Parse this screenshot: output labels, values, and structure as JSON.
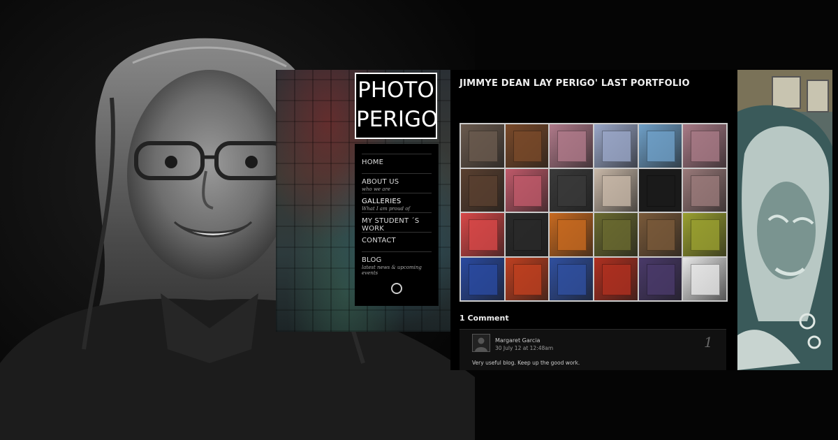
{
  "logo": {
    "line1": "PHOTO",
    "line2": "PERIGO"
  },
  "nav": {
    "items": [
      {
        "label": "HOME",
        "sub": ""
      },
      {
        "label": "ABOUT US",
        "sub": "who we are"
      },
      {
        "label": "GALLERIES",
        "sub": "What I am proud of"
      },
      {
        "label": "MY STUDENT ´S WORK",
        "sub": ""
      },
      {
        "label": "CONTACT",
        "sub": ""
      },
      {
        "label": "BLOG",
        "sub": "latest news  &  upcoming events"
      }
    ],
    "active_index": 2
  },
  "post": {
    "title": "JIMMYE DEAN LAY PERIGO' LAST PORTFOLIO"
  },
  "gallery": {
    "thumbs": [
      "#6a5a4e",
      "#7a4a2a",
      "#b07a8a",
      "#9aa7c8",
      "#6fa0c8",
      "#a87a86",
      "#5a4030",
      "#c05a6a",
      "#3a3a3a",
      "#c8b8a8",
      "#1a1a1a",
      "#9a7a7a",
      "#d84848",
      "#2a2a2a",
      "#c86a20",
      "#6a6a30",
      "#7a5a3a",
      "#9aa030",
      "#2a4aa0",
      "#c04020",
      "#3050a0",
      "#b03020",
      "#4a3a6a",
      "#e8e8e8"
    ]
  },
  "comments": {
    "count_label": "1 Comment",
    "items": [
      {
        "author": "Margaret Garcia",
        "date": "30 July 12 at 12:48am",
        "number": "1",
        "text": "Very useful blog. Keep up the good work."
      }
    ]
  },
  "colors": {
    "background": "#050505",
    "panel": "#000000",
    "accent": "#ffffff"
  }
}
